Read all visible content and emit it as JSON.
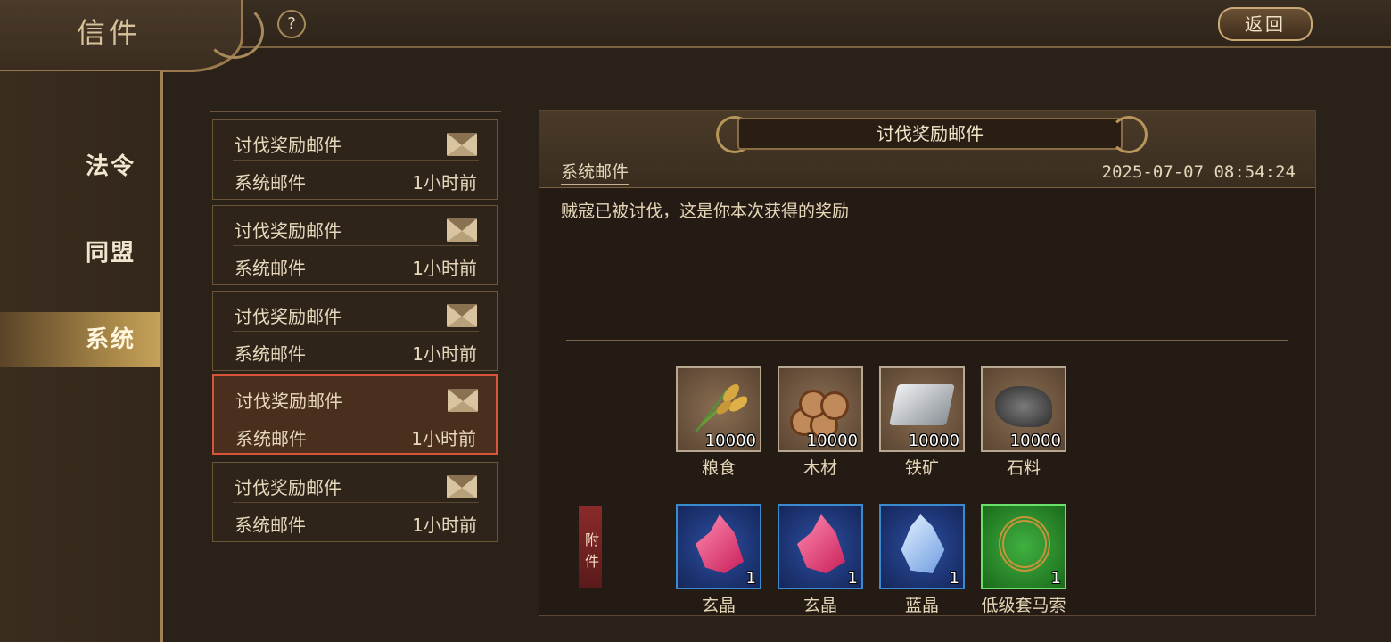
{
  "header": {
    "title": "信件",
    "help_label": "?",
    "back_label": "返回"
  },
  "sidebar": {
    "items": [
      {
        "label": "法令",
        "active": false
      },
      {
        "label": "同盟",
        "active": false
      },
      {
        "label": "系统",
        "active": true
      }
    ]
  },
  "mail_list": [
    {
      "title": "讨伐奖励邮件",
      "sender": "系统邮件",
      "time": "1小时前",
      "selected": false
    },
    {
      "title": "讨伐奖励邮件",
      "sender": "系统邮件",
      "time": "1小时前",
      "selected": false
    },
    {
      "title": "讨伐奖励邮件",
      "sender": "系统邮件",
      "time": "1小时前",
      "selected": false
    },
    {
      "title": "讨伐奖励邮件",
      "sender": "系统邮件",
      "time": "1小时前",
      "selected": true
    },
    {
      "title": "讨伐奖励邮件",
      "sender": "系统邮件",
      "time": "1小时前",
      "selected": false
    }
  ],
  "detail": {
    "subject": "讨伐奖励邮件",
    "sender": "系统邮件",
    "datetime": "2025-07-07 08:54:24",
    "body": "贼寇已被讨伐，这是你本次获得的奖励",
    "attachment_tag": "附件",
    "resources": [
      {
        "name": "粮食",
        "qty": "10000",
        "icon": "grain-icon"
      },
      {
        "name": "木材",
        "qty": "10000",
        "icon": "wood-icon"
      },
      {
        "name": "铁矿",
        "qty": "10000",
        "icon": "iron-ore-icon"
      },
      {
        "name": "石料",
        "qty": "10000",
        "icon": "stone-icon"
      }
    ],
    "items": [
      {
        "name": "玄晶",
        "qty": "1",
        "icon": "red-crystal-icon",
        "rarity_color": "#3a8ad0"
      },
      {
        "name": "玄晶",
        "qty": "1",
        "icon": "red-crystal-icon",
        "rarity_color": "#3a8ad0"
      },
      {
        "name": "蓝晶",
        "qty": "1",
        "icon": "blue-crystal-icon",
        "rarity_color": "#3a8ad0"
      },
      {
        "name": "低级套马索",
        "qty": "1",
        "icon": "lasso-rope-icon",
        "rarity_color": "#6ae06a"
      }
    ]
  }
}
